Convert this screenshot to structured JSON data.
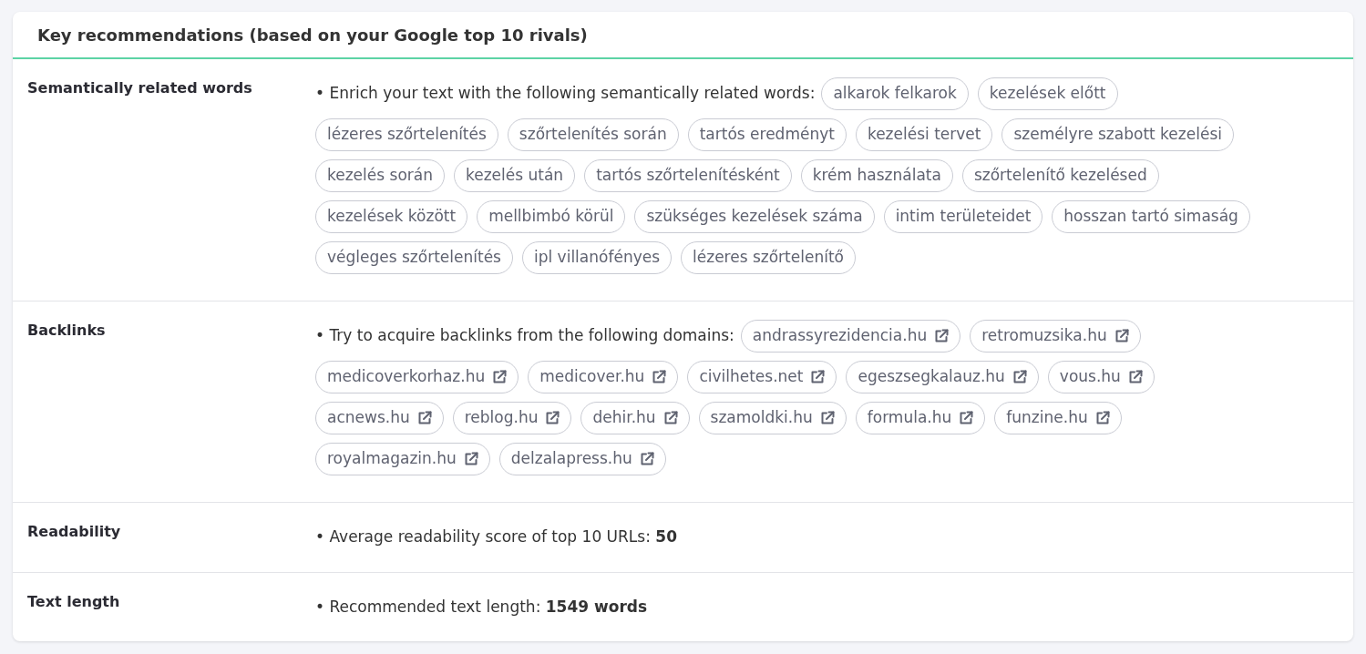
{
  "card": {
    "title": "Key recommendations (based on your Google top 10 rivals)"
  },
  "sections": [
    {
      "kind": "words",
      "label": "Semantically related words",
      "intro": "• Enrich your text with the following semantically related words:",
      "chips": [
        "alkarok felkarok",
        "kezelések előtt",
        "lézeres szőrtelenítés",
        "szőrtelenítés során",
        "tartós eredményt",
        "kezelési tervet",
        "személyre szabott kezelési",
        "kezelés során",
        "kezelés után",
        "tartós szőrtelenítésként",
        "krém használata",
        "szőrtelenítő kezelésed",
        "kezelések között",
        "mellbimbó körül",
        "szükséges kezelések száma",
        "intim területeidet",
        "hosszan tartó simaság",
        "végleges szőrtelenítés",
        "ipl villanófényes",
        "lézeres szőrtelenítő"
      ]
    },
    {
      "kind": "links",
      "label": "Backlinks",
      "intro": "• Try to acquire backlinks from the following domains:",
      "chips": [
        "andrassyrezidencia.hu",
        "retromuzsika.hu",
        "medicoverkorhaz.hu",
        "medicover.hu",
        "civilhetes.net",
        "egeszsegkalauz.hu",
        "vous.hu",
        "acnews.hu",
        "reblog.hu",
        "dehir.hu",
        "szamoldki.hu",
        "formula.hu",
        "funzine.hu",
        "royalmagazin.hu",
        "delzalapress.hu"
      ]
    },
    {
      "kind": "text",
      "label": "Readability",
      "text": "• Average readability score of top 10 URLs: **50**"
    },
    {
      "kind": "text",
      "label": "Text length",
      "text": "• Recommended text length: **1549 words**"
    }
  ]
}
